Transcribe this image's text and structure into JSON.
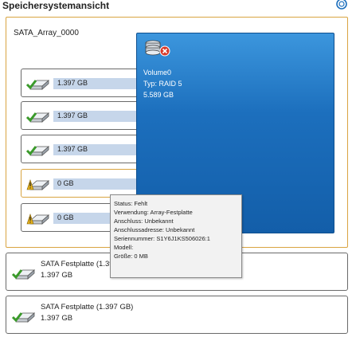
{
  "header": {
    "title": "Speichersystemansicht",
    "refresh_icon": "refresh-icon"
  },
  "array": {
    "name": "SATA_Array_0000",
    "disks": [
      {
        "label": "1.397 GB",
        "status": "ok",
        "icon": "disk-ok-icon"
      },
      {
        "label": "1.397 GB",
        "status": "ok",
        "icon": "disk-ok-icon"
      },
      {
        "label": "1.397 GB",
        "status": "ok",
        "icon": "disk-ok-icon"
      },
      {
        "label": "0 GB",
        "status": "missing",
        "icon": "disk-warning-icon"
      },
      {
        "label": "0 GB",
        "status": "missing",
        "icon": "disk-warning-icon"
      }
    ]
  },
  "volume": {
    "name": "Volume0",
    "type": "Typ: RAID 5",
    "size": "5.589 GB",
    "icon": "volume-error-icon"
  },
  "tooltip": {
    "lines": [
      "Status: Fehlt",
      "Verwendung: Array-Festplatte",
      "Anschluss: Unbekannt",
      "Anschlussadresse: Unbekannt",
      "Seriennummer: S1Y6J1KS506026:1",
      "Modell:",
      "Größe: 0 MB"
    ]
  },
  "physical_disks": [
    {
      "name": "SATA Festplatte (1.397 GB)",
      "size": "1.397 GB"
    },
    {
      "name": "SATA Festplatte (1.397 GB)",
      "size": "1.397 GB"
    }
  ],
  "colors": {
    "array_border": "#d9a441",
    "volume_blue": "#1c6fbd",
    "disk_bar": "#c6d6ea",
    "ok_green": "#3a9a2a",
    "warn_yellow": "#e6b21c",
    "error_red": "#d83a2a"
  }
}
